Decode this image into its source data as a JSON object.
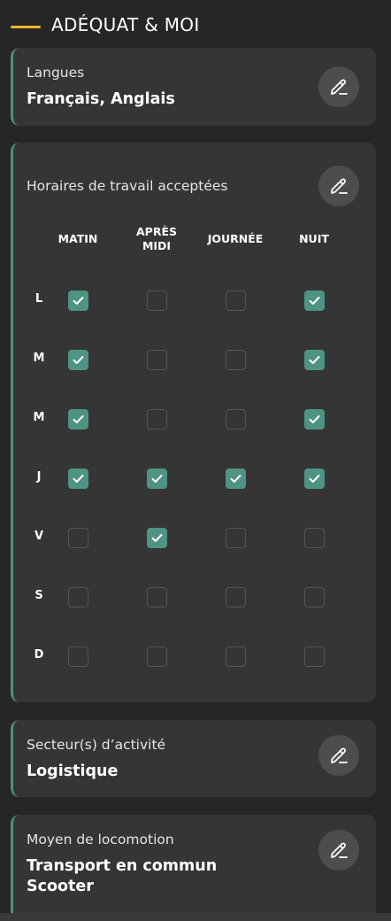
{
  "header": {
    "title": "ADÉQUAT & MOI",
    "accent": "#e8b830"
  },
  "langues": {
    "label": "Langues",
    "value": "Français, Anglais"
  },
  "horaires": {
    "label": "Horaires de travail acceptées",
    "columns": [
      "MATIN",
      "APRÈS\nMIDI",
      "JOURNÉE",
      "NUIT"
    ],
    "days": [
      {
        "label": "L",
        "checks": [
          true,
          false,
          false,
          true
        ]
      },
      {
        "label": "M",
        "checks": [
          true,
          false,
          false,
          true
        ]
      },
      {
        "label": "M",
        "checks": [
          true,
          false,
          false,
          true
        ]
      },
      {
        "label": "J",
        "checks": [
          true,
          true,
          true,
          true
        ]
      },
      {
        "label": "V",
        "checks": [
          false,
          true,
          false,
          false
        ]
      },
      {
        "label": "S",
        "checks": [
          false,
          false,
          false,
          false
        ]
      },
      {
        "label": "D",
        "checks": [
          false,
          false,
          false,
          false
        ]
      }
    ]
  },
  "secteur": {
    "label": "Secteur(s) d’activité",
    "value": "Logistique"
  },
  "locomotion": {
    "label": "Moyen de locomotion",
    "values": [
      "Transport en commun",
      "Scooter"
    ]
  },
  "icons": {
    "edit": "pencil-icon",
    "check": "checkmark-icon"
  },
  "colors": {
    "background": "#262626",
    "card": "#353535",
    "accent_green": "#4e9384",
    "accent_yellow": "#e8b830"
  }
}
